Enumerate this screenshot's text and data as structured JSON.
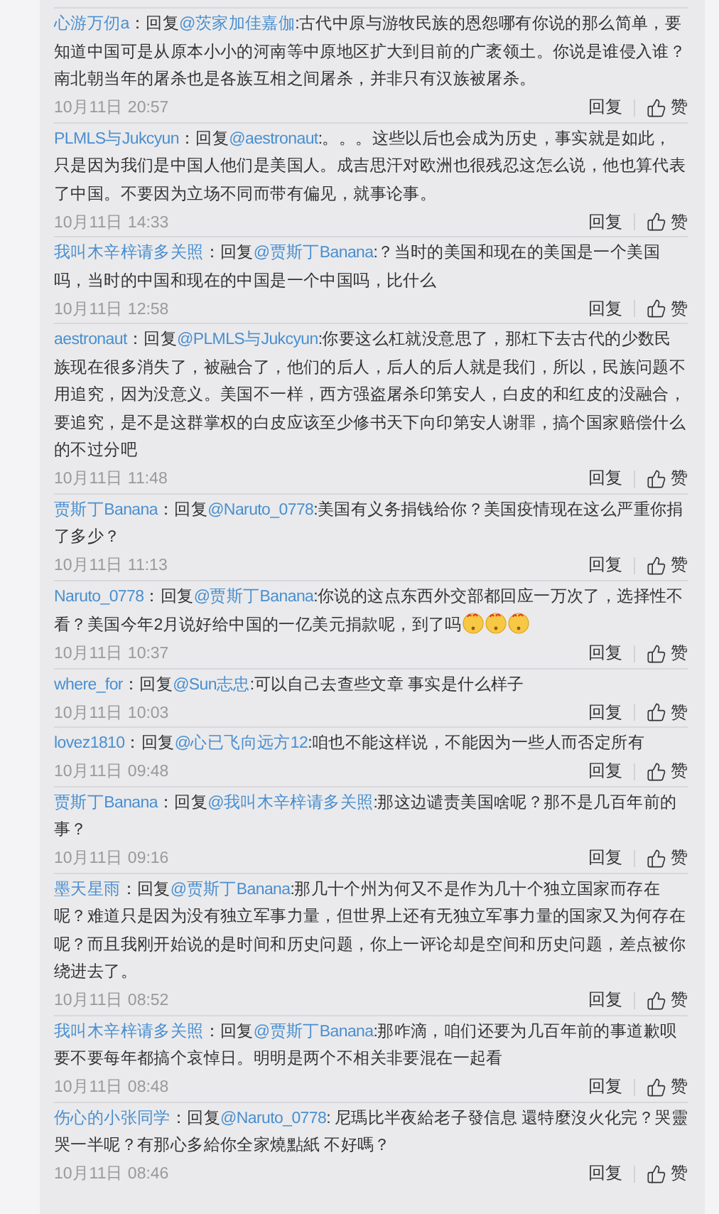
{
  "comments": [
    {
      "user": "心游万仞a",
      "reply_label": "：回复",
      "mention": "@茨家加佳嘉伽",
      "text": ":古代中原与游牧民族的恩怨哪有你说的那么简单，要知道中国可是从原本小小的河南等中原地区扩大到目前的广袤领土。你说是谁侵入谁？南北朝当年的屠杀也是各族互相之间屠杀，并非只有汉族被屠杀。",
      "time": "10月11日 20:57",
      "reply": "回复",
      "like": "赞"
    },
    {
      "user": "PLMLS与Jukcyun",
      "reply_label": "：回复",
      "mention": "@aestronaut",
      "text": ":。。。这些以后也会成为历史，事实就是如此，只是因为我们是中国人他们是美国人。成吉思汗对欧洲也很残忍这怎么说，他也算代表了中国。不要因为立场不同而带有偏见，就事论事。",
      "time": "10月11日 14:33",
      "reply": "回复",
      "like": "赞"
    },
    {
      "user": "我叫木辛梓请多关照",
      "reply_label": "：回复",
      "mention": "@贾斯丁Banana",
      "text": ":？当时的美国和现在的美国是一个美国吗，当时的中国和现在的中国是一个中国吗，比什么",
      "time": "10月11日 12:58",
      "reply": "回复",
      "like": "赞"
    },
    {
      "user": "aestronaut",
      "reply_label": "：回复",
      "mention": "@PLMLS与Jukcyun",
      "text": ":你要这么杠就没意思了，那杠下去古代的少数民族现在很多消失了，被融合了，他们的后人，后人的后人就是我们，所以，民族问题不用追究，因为没意义。美国不一样，西方强盗屠杀印第安人，白皮的和红皮的没融合，要追究，是不是这群掌权的白皮应该至少修书天下向印第安人谢罪，搞个国家赔偿什么的不过分吧",
      "time": "10月11日 11:48",
      "reply": "回复",
      "like": "赞"
    },
    {
      "user": "贾斯丁Banana",
      "reply_label": "：回复",
      "mention": "@Naruto_0778",
      "text": ":美国有义务捐钱给你？美国疫情现在这么严重你捐了多少？",
      "time": "10月11日 11:13",
      "reply": "回复",
      "like": "赞"
    },
    {
      "user": "Naruto_0778",
      "reply_label": "：回复",
      "mention": "@贾斯丁Banana",
      "text": ":你说的这点东西外交部都回应一万次了，选择性不看？美国今年2月说好给中国的一亿美元捐款呢，到了吗",
      "emojis": [
        {
          "kind": "puzzled"
        },
        {
          "kind": "puzzled"
        },
        {
          "kind": "puzzled"
        }
      ],
      "time": "10月11日 10:37",
      "reply": "回复",
      "like": "赞"
    },
    {
      "user": "where_for",
      "reply_label": "：回复",
      "mention": "@Sun志忠",
      "text": ":可以自己去查些文章 事实是什么样子",
      "time": "10月11日 10:03",
      "reply": "回复",
      "like": "赞"
    },
    {
      "user": "lovez1810",
      "reply_label": "：回复",
      "mention": "@心已飞向远方12",
      "text": ":咱也不能这样说，不能因为一些人而否定所有",
      "time": "10月11日 09:48",
      "reply": "回复",
      "like": "赞"
    },
    {
      "user": "贾斯丁Banana",
      "reply_label": "：回复",
      "mention": "@我叫木辛梓请多关照",
      "text": ":那这边谴责美国啥呢？那不是几百年前的事？",
      "time": "10月11日 09:16",
      "reply": "回复",
      "like": "赞"
    },
    {
      "user": "墨天星雨",
      "reply_label": "：回复",
      "mention": "@贾斯丁Banana",
      "text": ":那几十个州为何又不是作为几十个独立国家而存在呢？难道只是因为没有独立军事力量，但世界上还有无独立军事力量的国家又为何存在呢？而且我刚开始说的是时间和历史问题，你上一评论却是空间和历史问题，差点被你绕进去了。",
      "time": "10月11日 08:52",
      "reply": "回复",
      "like": "赞"
    },
    {
      "user": "我叫木辛梓请多关照",
      "reply_label": "：回复",
      "mention": "@贾斯丁Banana",
      "text": ":那咋滴，咱们还要为几百年前的事道歉呗要不要每年都搞个哀悼日。明明是两个不相关非要混在一起看",
      "time": "10月11日 08:48",
      "reply": "回复",
      "like": "赞"
    },
    {
      "user": "伤心的小张同学",
      "reply_label": "：回复",
      "mention": "@Naruto_0778",
      "text": ": 尼瑪比半夜給老子發信息 還特麼沒火化完？哭靈哭一半呢？有那心多給你全家燒點紙 不好嗎？",
      "time": "10月11日 08:46",
      "reply": "回复",
      "like": "赞"
    }
  ]
}
